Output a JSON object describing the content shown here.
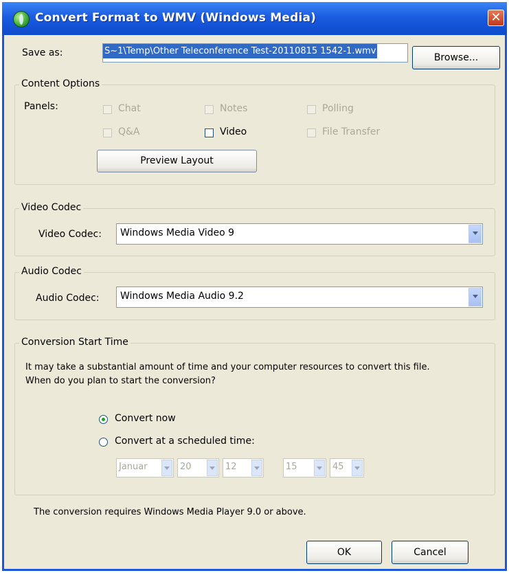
{
  "window": {
    "title": "Convert Format to WMV (Windows Media)",
    "close_label": "✕"
  },
  "save_as": {
    "label": "Save as:",
    "value": "S~1\\Temp\\Other Teleconference Test-20110815 1542-1.wmv",
    "browse_label": "Browse..."
  },
  "content_options": {
    "title": "Content Options",
    "panels_label": "Panels:",
    "panels": [
      {
        "label": "Chat",
        "checked": false,
        "enabled": false
      },
      {
        "label": "Notes",
        "checked": false,
        "enabled": false
      },
      {
        "label": "Polling",
        "checked": false,
        "enabled": false
      },
      {
        "label": "Q&A",
        "checked": false,
        "enabled": false
      },
      {
        "label": "Video",
        "checked": false,
        "enabled": true
      },
      {
        "label": "File Transfer",
        "checked": false,
        "enabled": false
      }
    ],
    "preview_label": "Preview Layout"
  },
  "video_codec": {
    "title": "Video Codec",
    "label": "Video Codec:",
    "value": "Windows Media Video 9"
  },
  "audio_codec": {
    "title": "Audio Codec",
    "label": "Audio Codec:",
    "value": "Windows Media Audio 9.2"
  },
  "conversion": {
    "title": "Conversion Start Time",
    "description_line1": "It may take a substantial amount of time and your computer resources to convert this file.",
    "description_line2": "When do you plan to start the conversion?",
    "convert_now_label": "Convert now",
    "convert_now_selected": true,
    "scheduled_label": "Convert at a scheduled time:",
    "month": "Januar",
    "day": "20",
    "year": "12",
    "hour": "15",
    "minute": "45"
  },
  "requirement_note": "The conversion requires Windows Media Player 9.0 or above.",
  "buttons": {
    "ok": "OK",
    "cancel": "Cancel"
  }
}
